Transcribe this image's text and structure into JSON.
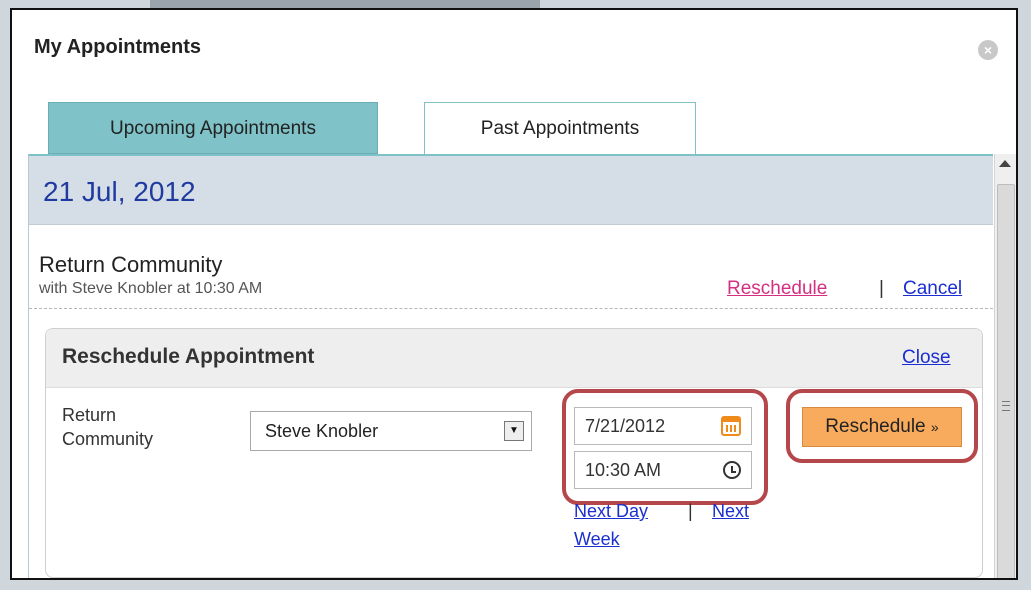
{
  "dialog": {
    "title": "My Appointments"
  },
  "tabs": [
    {
      "label": "Upcoming Appointments",
      "active": true
    },
    {
      "label": "Past Appointments",
      "active": false
    }
  ],
  "date_header": "21 Jul, 2012",
  "appointment": {
    "title": "Return Community",
    "subtitle": "with Steve Knobler at 10:30 AM",
    "actions": {
      "reschedule": "Reschedule",
      "separator": "|",
      "cancel": "Cancel"
    }
  },
  "reschedule_panel": {
    "title": "Reschedule Appointment",
    "close": "Close",
    "label": "Return Community",
    "provider_selected": "Steve Knobler",
    "date_value": "7/21/2012",
    "time_value": "10:30 AM",
    "next_day": "Next Day",
    "separator": "|",
    "next_week_1": "Next",
    "next_week_2": "Week",
    "button": "Reschedule",
    "button_suffix": "»"
  },
  "colors": {
    "accent_tab": "#7fc2c8",
    "date_text": "#1f3aa0",
    "link": "#1b2fd0",
    "link_pink": "#d42f82",
    "button": "#f9ab5d",
    "highlight": "#b5474b"
  },
  "icons": [
    "close-icon",
    "calendar-icon",
    "clock-icon",
    "chevron-down-icon",
    "scroll-up-icon"
  ]
}
